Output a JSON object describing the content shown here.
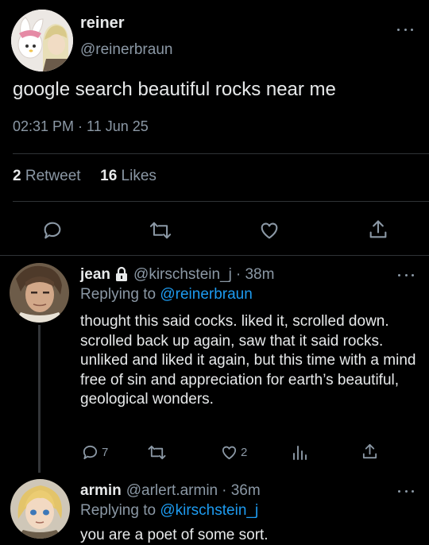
{
  "tweet": {
    "display_name": "reiner",
    "handle": "@reinerbraun",
    "text": "google search beautiful rocks near me",
    "timestamp": "02:31 PM · 11 Jun 25",
    "retweets_count": "2",
    "retweets_label": "Retweet",
    "likes_count": "16",
    "likes_label": "Likes"
  },
  "replies": [
    {
      "display_name": "jean",
      "handle": "@kirschstein_j",
      "time": "· 38m",
      "replying_prefix": "Replying to",
      "replying_to": "@reinerbraun",
      "text": "thought this said cocks. liked it, scrolled down. scrolled back up again, saw that it said rocks. unliked and liked it again, but this time with a mind free of sin and appreciation for earth’s beautiful, geological wonders.",
      "reply_count": "7",
      "like_count": "2"
    },
    {
      "display_name": "armin",
      "handle": "@arlert.armin",
      "time": "· 36m",
      "replying_prefix": "Replying to",
      "replying_to": "@kirschstein_j",
      "text": "you are a poet of some sort."
    }
  ],
  "icons": {
    "reply": "reply-icon",
    "retweet": "retweet-icon",
    "like": "heart-icon",
    "share": "share-icon",
    "analytics": "analytics-icon",
    "more": "more-icon",
    "lock": "lock-icon"
  },
  "colors": {
    "background": "#000000",
    "text": "#e7e9ea",
    "muted": "#8b98a5",
    "link": "#1d9bf0"
  }
}
